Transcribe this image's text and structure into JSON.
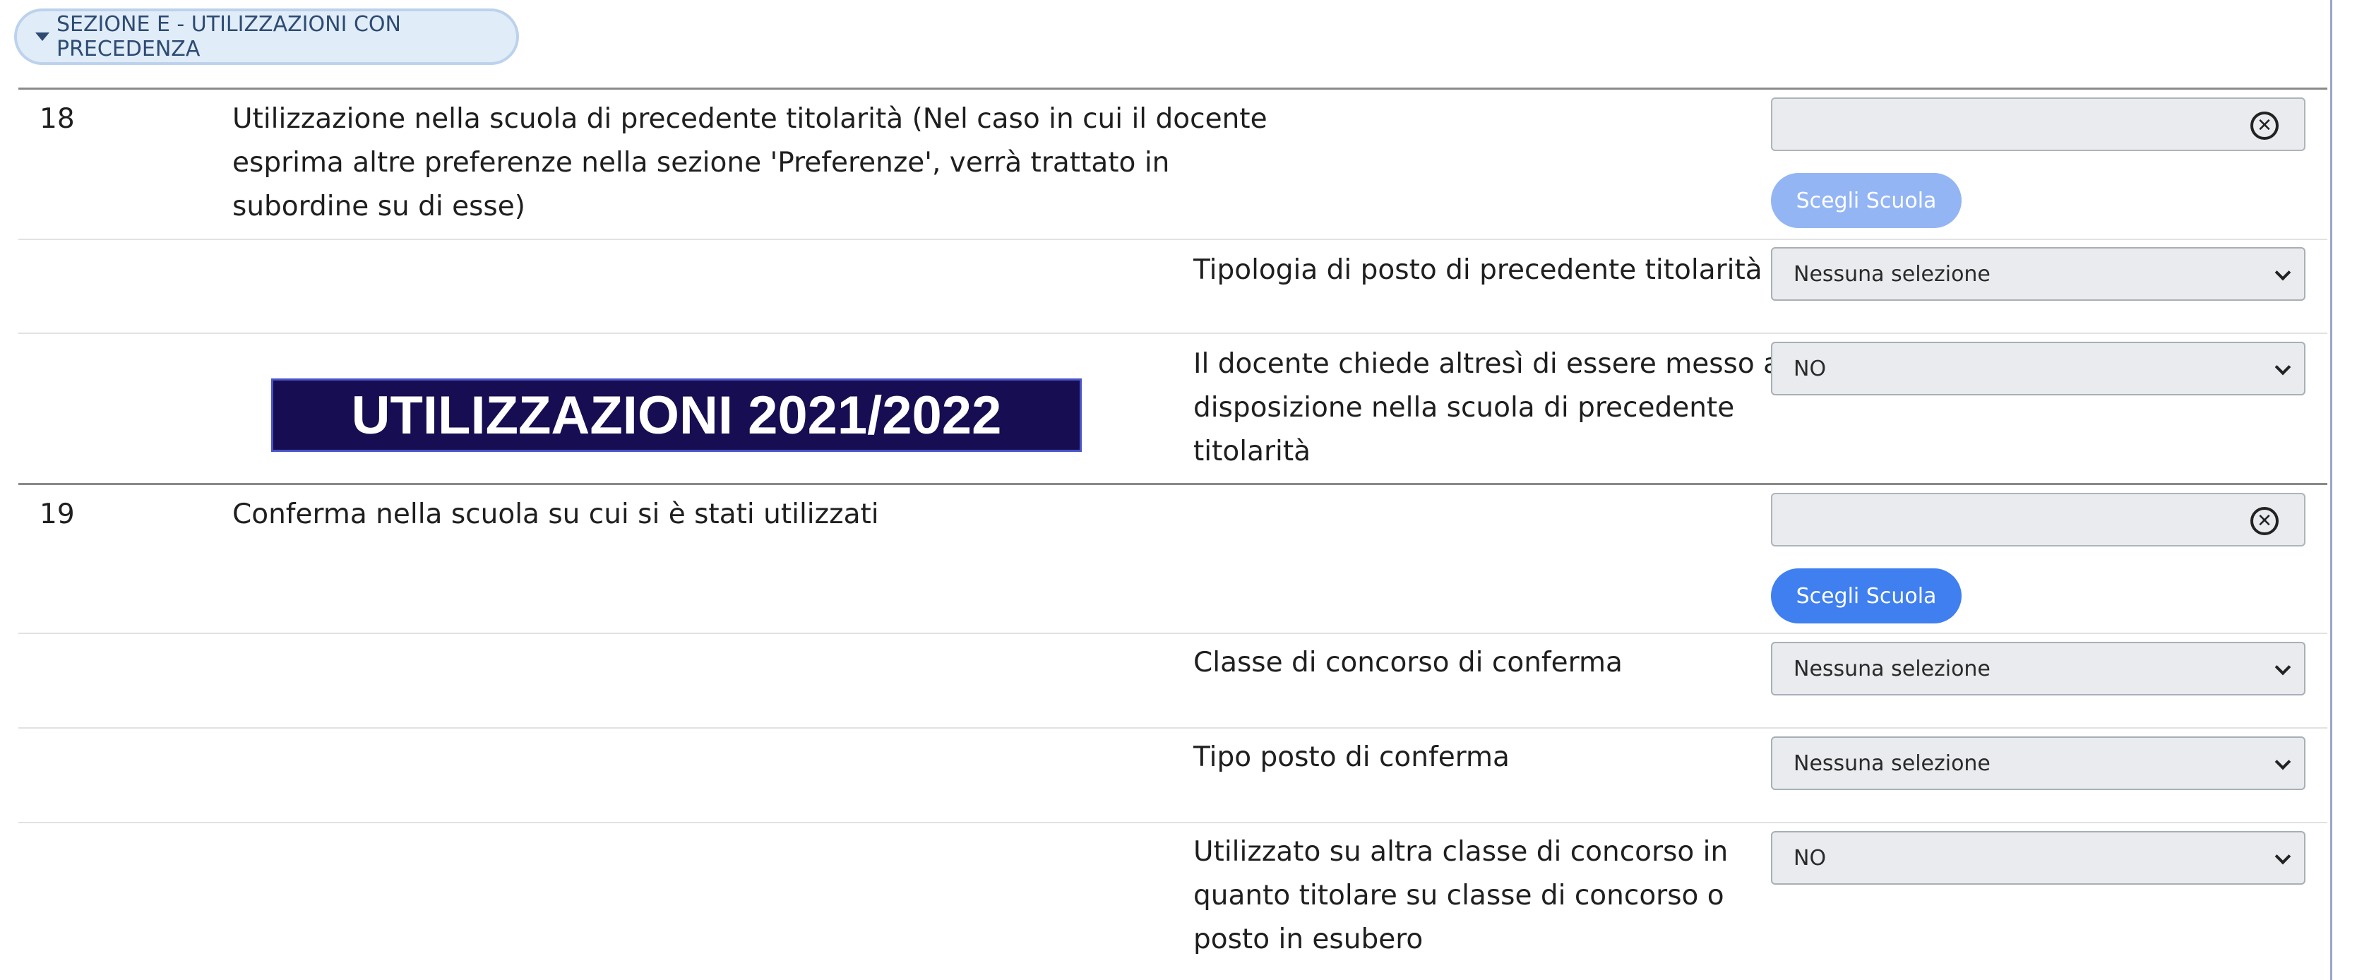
{
  "section": {
    "title": "SEZIONE E - UTILIZZAZIONI CON PRECEDENZA"
  },
  "banner": {
    "text": "UTILIZZAZIONI 2021/2022"
  },
  "item18": {
    "number": "18",
    "description_lines": [
      "Utilizzazione nella scuola di precedente titolarità (Nel caso in cui il docente",
      "esprima altre preferenze nella sezione 'Preferenze', verrà trattato in",
      "subordine su di esse)"
    ],
    "choose_button": "Scegli Scuola",
    "clear_symbol": "✕",
    "tipologia": {
      "label": "Tipologia di posto di precedente titolarità",
      "value": "Nessuna selezione"
    },
    "disposizione": {
      "label_lines": [
        "Il docente chiede altresì di essere messo a",
        "disposizione nella scuola di precedente",
        "titolarità"
      ],
      "value": "NO"
    }
  },
  "item19": {
    "number": "19",
    "description": "Conferma nella scuola su cui si è stati utilizzati",
    "choose_button": "Scegli Scuola",
    "clear_symbol": "✕",
    "classe": {
      "label": "Classe di concorso di conferma",
      "value": "Nessuna selezione"
    },
    "tipo_posto": {
      "label": "Tipo posto di conferma",
      "value": "Nessuna selezione"
    },
    "altra_classe": {
      "label_lines": [
        "Utilizzato su altra classe di concorso in",
        "quanto titolare su classe di concorso o",
        "posto in esubero"
      ],
      "value": "NO"
    }
  }
}
